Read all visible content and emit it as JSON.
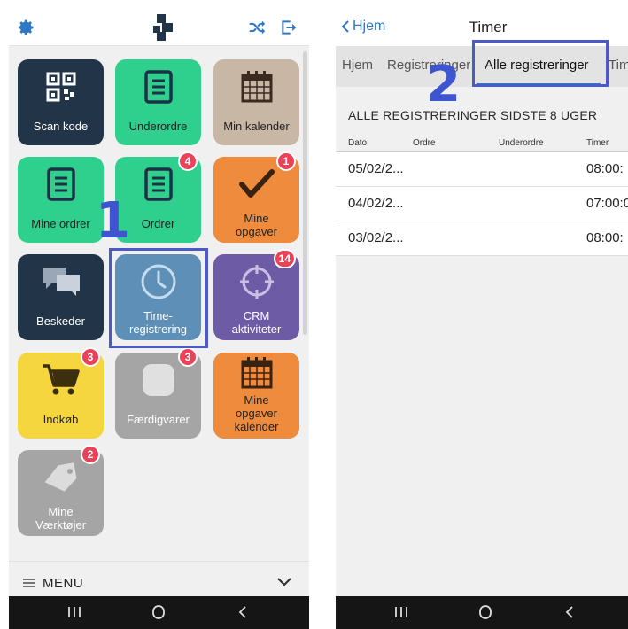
{
  "left_screen": {
    "top_bar": {
      "settings_icon": "gear-icon",
      "logo_icon": "app-logo",
      "shuffle_icon": "shuffle-icon",
      "logout_icon": "logout-icon"
    },
    "tiles": [
      {
        "label": "Scan kode",
        "icon": "qr-code-icon",
        "color": "#223548"
      },
      {
        "label": "Underordre",
        "icon": "document-icon",
        "color": "#2fcf8e"
      },
      {
        "label": "Min kalender",
        "icon": "calendar-icon",
        "color": "#c9b7a6"
      },
      {
        "label": "Mine ordrer",
        "icon": "document-icon",
        "color": "#2fcf8e"
      },
      {
        "label": "Ordrer",
        "icon": "document-icon",
        "color": "#2fcf8e",
        "badge": "4"
      },
      {
        "label": "Mine opgaver",
        "icon": "checkmark-icon",
        "color": "#ef8b3d",
        "badge": "1"
      },
      {
        "label": "Beskeder",
        "icon": "chat-icon",
        "color": "#223548"
      },
      {
        "label": "Time-registrering",
        "icon": "clock-icon",
        "color": "#5d8fb7"
      },
      {
        "label": "CRM aktiviteter",
        "icon": "crosshair-icon",
        "color": "#6e5ba6",
        "badge": "14"
      },
      {
        "label": "Indkøb",
        "icon": "cart-icon",
        "color": "#f5d63f",
        "badge": "3"
      },
      {
        "label": "Færdigvarer",
        "icon": "box-icon",
        "color": "#a5a5a5",
        "badge": "3"
      },
      {
        "label": "Mine opgaver kalender",
        "icon": "calendar-icon",
        "color": "#ef8b3d"
      },
      {
        "label": "Mine Værktøjer",
        "icon": "tag-icon",
        "color": "#a5a5a5",
        "badge": "2"
      }
    ],
    "tile_labels": {
      "scan": "Scan kode",
      "underordre": "Underordre",
      "min_kalender": "Min kalender",
      "mine_ordrer": "Mine ordrer",
      "ordrer": "Ordrer",
      "mine_opgaver_1": "Mine",
      "mine_opgaver_2": "opgaver",
      "beskeder": "Beskeder",
      "time_1": "Time-",
      "time_2": "registrering",
      "crm_1": "CRM",
      "crm_2": "aktiviteter",
      "indkob": "Indkøb",
      "faerdigvarer": "Færdigvarer",
      "mok_1": "Mine",
      "mok_2": "opgaver",
      "mok_3": "kalender",
      "vaerktojer_1": "Mine",
      "vaerktojer_2": "Værktøjer"
    },
    "badges": {
      "ordrer": "4",
      "mine_opgaver": "1",
      "crm": "14",
      "indkob": "3",
      "faerdigvarer": "3",
      "vaerktojer": "2"
    },
    "step_marker": "1",
    "menu": {
      "label": "MENU",
      "icon": "hamburger-icon",
      "chevron": "chevron-down-icon"
    }
  },
  "right_screen": {
    "back_label": "Hjem",
    "title": "Timer",
    "tabs": [
      "Hjem",
      "Registreringer",
      "Alle registreringer",
      "Timer"
    ],
    "active_tab": "Alle registreringer",
    "step_marker": "2",
    "section_title": "ALLE REGISTRERINGER SIDSTE 8 UGER",
    "columns": [
      "Dato",
      "Ordre",
      "Underordre",
      "Timer"
    ],
    "rows": [
      {
        "dato": "05/02/2...",
        "ordre": "",
        "underordre": "",
        "timer": "08:00:"
      },
      {
        "dato": "04/02/2...",
        "ordre": "",
        "underordre": "",
        "timer": "07:00:0"
      },
      {
        "dato": "03/02/2...",
        "ordre": "",
        "underordre": "",
        "timer": "08:00:"
      }
    ]
  },
  "system_nav": {
    "recents": "recents-icon",
    "home": "home-icon",
    "back": "back-icon"
  },
  "colors": {
    "highlight": "#4a5bc7",
    "accent": "#2f78c4",
    "badge": "#e84359"
  }
}
